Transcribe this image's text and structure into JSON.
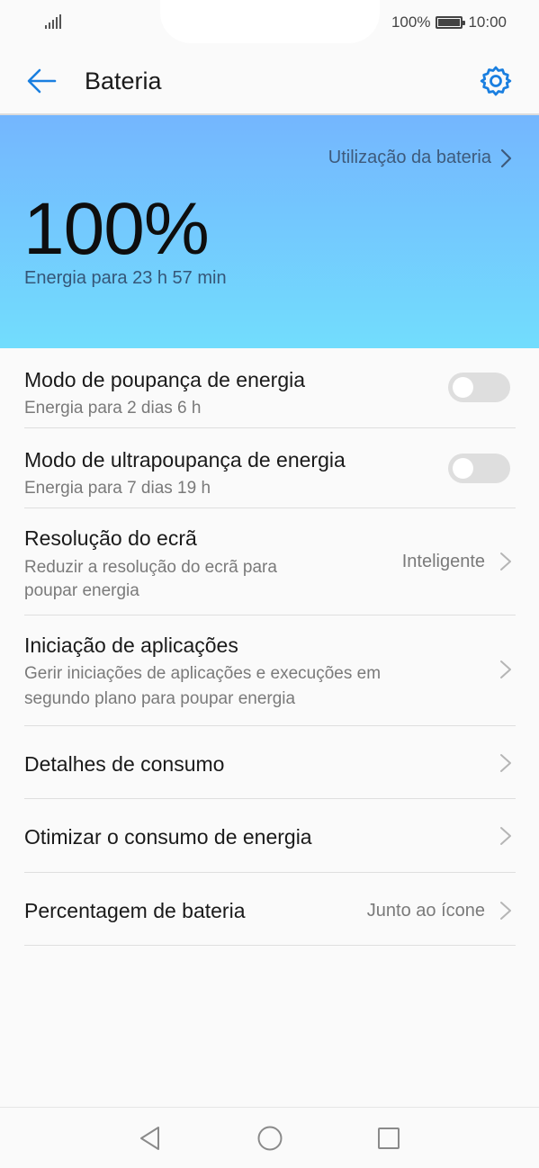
{
  "status_bar": {
    "battery_percent": "100%",
    "time": "10:00"
  },
  "app_bar": {
    "title": "Bateria",
    "back_icon": "arrow-left-icon",
    "settings_icon": "gear-icon",
    "accent": "#1a7fe0"
  },
  "hero": {
    "usage_link": "Utilização da bateria",
    "percent": "100%",
    "remaining": "Energia para 23 h 57 min",
    "gradient_top": "#74b6fe",
    "gradient_bottom": "#72ddfd"
  },
  "settings": [
    {
      "title": "Modo de poupança de energia",
      "subtitle": "Energia para 2 dias 6 h",
      "toggle_on": false
    },
    {
      "title": "Modo de ultrapoupança de energia",
      "subtitle": "Energia para 7 dias 19 h",
      "toggle_on": false
    },
    {
      "title": "Resolução do ecrã",
      "subtitle_line1": "Reduzir a resolução do ecrã para",
      "subtitle_line2": "poupar energia",
      "value": "Inteligente"
    },
    {
      "title": "Iniciação de aplicações",
      "subtitle_line1": "Gerir iniciações de aplicações e execuções em",
      "subtitle_line2": "segundo plano para poupar energia"
    },
    {
      "title": "Detalhes de consumo"
    },
    {
      "title": "Otimizar o consumo de energia"
    },
    {
      "title": "Percentagem de bateria",
      "value": "Junto ao ícone"
    }
  ],
  "nav_bar": {
    "back": "triangle-back-icon",
    "home": "circle-home-icon",
    "recents": "square-recents-icon"
  }
}
